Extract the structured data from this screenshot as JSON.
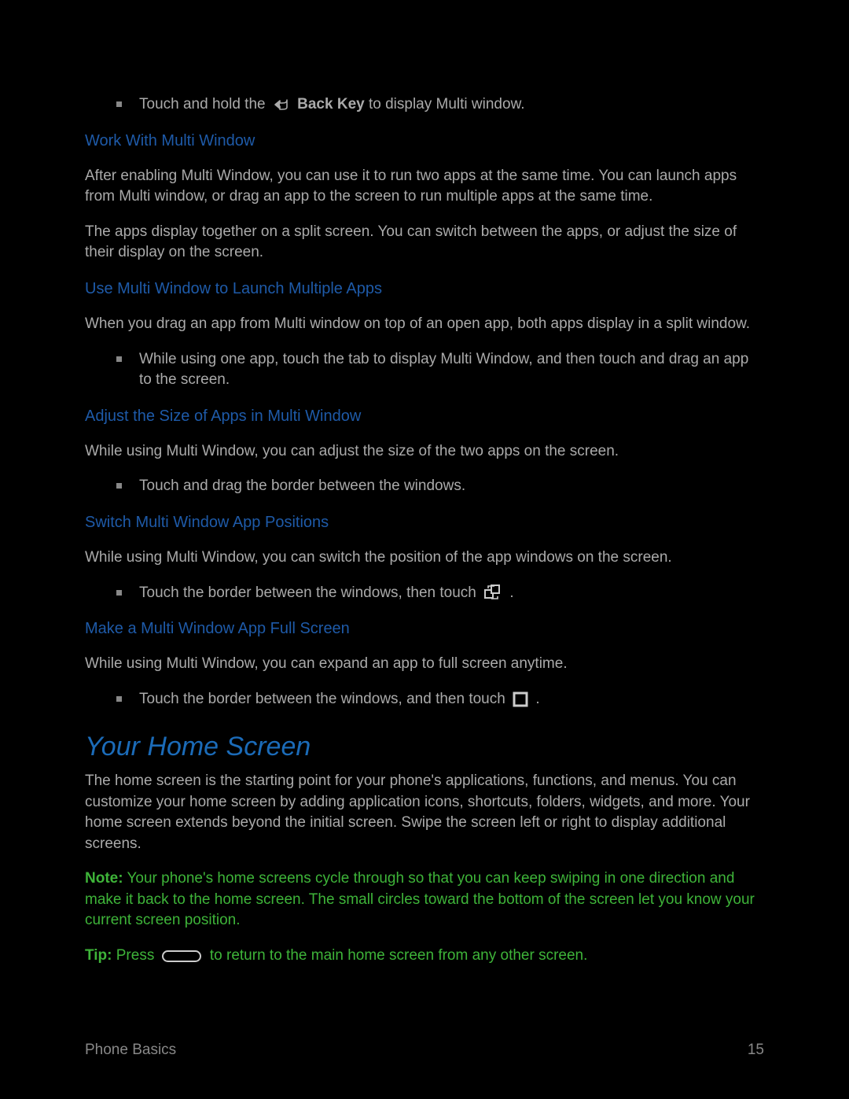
{
  "bullet1_pre": "Touch and hold the ",
  "bullet1_key": "Back Key",
  "bullet1_post": " to display Multi window.",
  "subhead1": "Work With Multi Window",
  "para1": "After enabling Multi Window, you can use it to run two apps at the same time. You can launch apps from Multi window, or drag an app to the screen to run multiple apps at the same time.",
  "para2": "The apps display together on a split screen. You can switch between the apps, or adjust the size of their display on the screen.",
  "subhead2": "Use Multi Window to Launch Multiple Apps",
  "para3": "When you drag an app from Multi window on top of an open app, both apps display in a split window.",
  "bullet2": "While using one app, touch the tab to display Multi Window, and then touch and drag an app to the screen.",
  "subhead3": "Adjust the Size of Apps in Multi Window",
  "para4": "While using Multi Window, you can adjust the size of the two apps on the screen.",
  "bullet3": "Touch and drag the border between the windows.",
  "subhead4": "Switch Multi Window App Positions",
  "para5": "While using Multi Window, you can switch the position of the app windows on the screen.",
  "bullet4_pre": "Touch the border between the windows, then touch ",
  "bullet4_post": ".",
  "subhead5": "Make a Multi Window App Full Screen",
  "para6": "While using Multi Window, you can expand an app to full screen anytime.",
  "bullet5_pre": "Touch the border between the windows, and then touch ",
  "bullet5_post": ".",
  "title": "Your Home Screen",
  "para7": "The home screen is the starting point for your phone's applications, functions, and menus. You can customize your home screen by adding application icons, shortcuts, folders, widgets, and more. Your home screen extends beyond the initial screen. Swipe the screen left or right to display additional screens.",
  "note_label": "Note:",
  "note_text": " Your phone's home screens cycle through so that you can keep swiping in one direction and make it back to the home screen. The small circles toward the bottom of the screen let you know your current screen position.",
  "tip_label": "Tip:",
  "tip_pre": " Press ",
  "tip_post": " to return to the main home screen from any other screen.",
  "footer_left": "Phone Basics",
  "footer_right": "15"
}
